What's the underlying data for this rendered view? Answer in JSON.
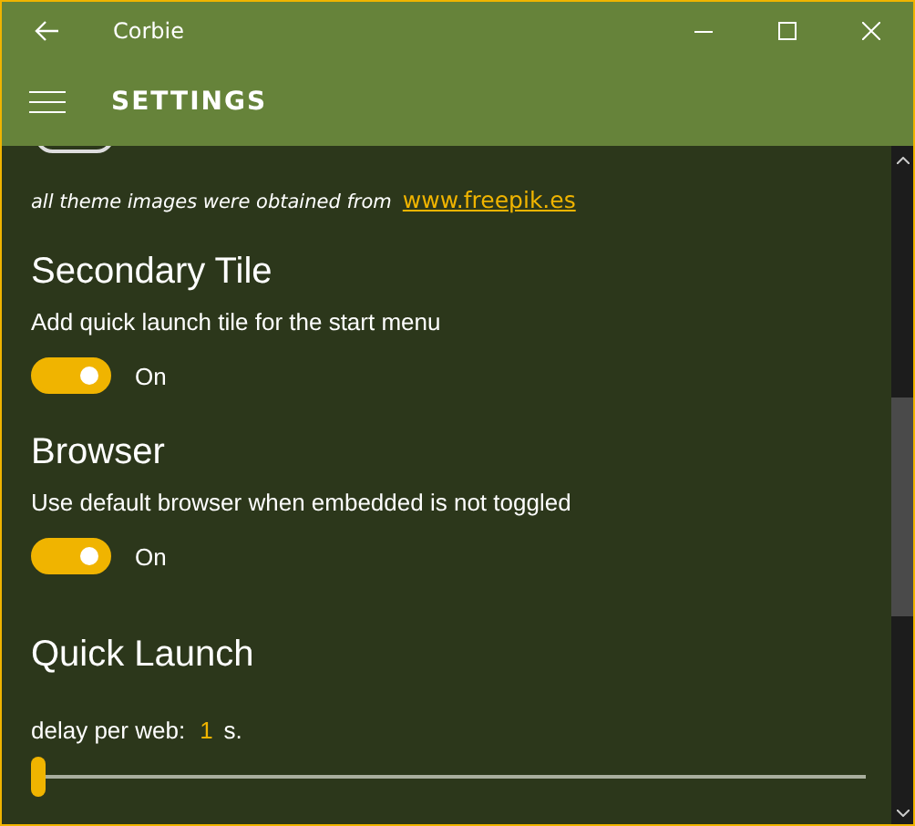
{
  "window": {
    "title": "Corbie"
  },
  "header": {
    "title": "SETTINGS"
  },
  "partial_toggle": {
    "on": false
  },
  "credit": {
    "text": "all theme images were obtained from",
    "link": "www.freepik.es"
  },
  "sections": [
    {
      "kind": "toggle",
      "title": "Secondary Tile",
      "description": "Add quick launch tile for the start menu",
      "on": true,
      "state_label": "On"
    },
    {
      "kind": "toggle",
      "title": "Browser",
      "description": "Use default browser when embedded is not toggled",
      "on": true,
      "state_label": "On"
    },
    {
      "kind": "slider",
      "title": "Quick Launch",
      "label": "delay per web:",
      "value": "1",
      "unit": "s.",
      "level": 0
    }
  ]
}
